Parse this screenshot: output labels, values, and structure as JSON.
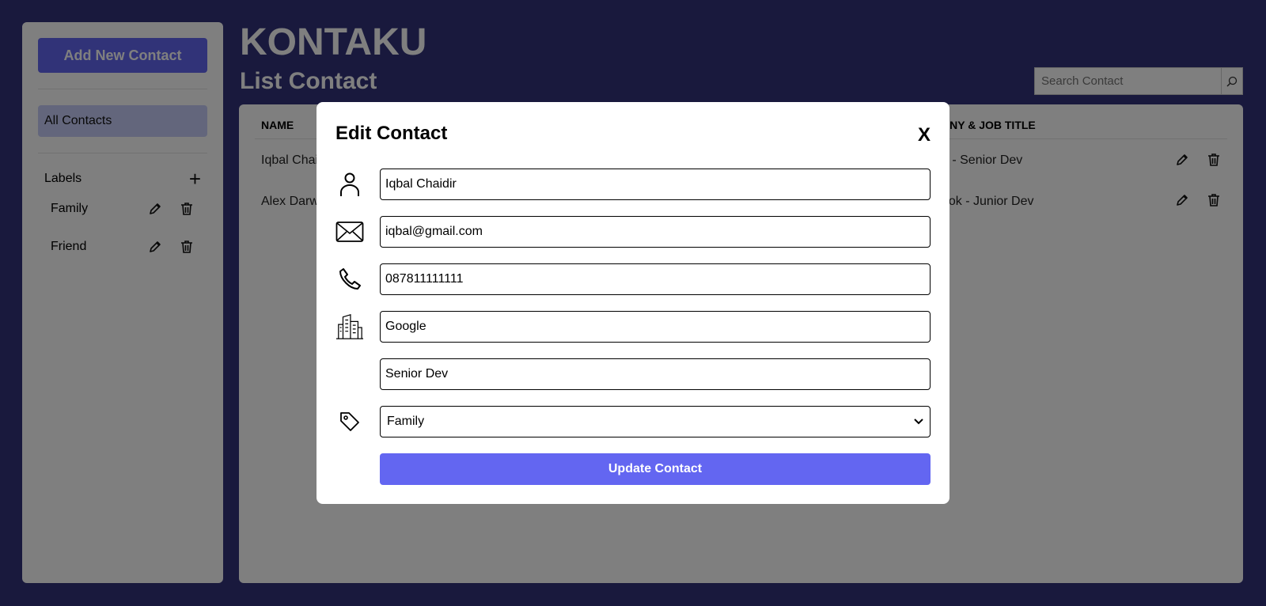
{
  "app": {
    "title": "KONTAKU",
    "subtitle": "List Contact"
  },
  "sidebar": {
    "add_button": "Add New Contact",
    "all_contacts": "All Contacts",
    "labels_heading": "Labels",
    "labels": [
      {
        "name": "Family"
      },
      {
        "name": "Friend"
      }
    ]
  },
  "search": {
    "placeholder": "Search Contact"
  },
  "table": {
    "headers": {
      "name": "NAME",
      "company": "ANY & JOB TITLE"
    },
    "rows": [
      {
        "name": "Iqbal Chai",
        "company": "e - Senior Dev"
      },
      {
        "name": "Alex Darw",
        "company": "ook - Junior Dev"
      }
    ]
  },
  "modal": {
    "title": "Edit Contact",
    "close": "X",
    "fields": {
      "name": "Iqbal Chaidir",
      "email": "iqbal@gmail.com",
      "phone": "087811111111",
      "company": "Google",
      "job_title": "Senior Dev",
      "label": "Family"
    },
    "submit": "Update Contact"
  },
  "colors": {
    "background": "#32327a",
    "accent": "#6366f1",
    "active_nav": "#c7cdf8"
  }
}
